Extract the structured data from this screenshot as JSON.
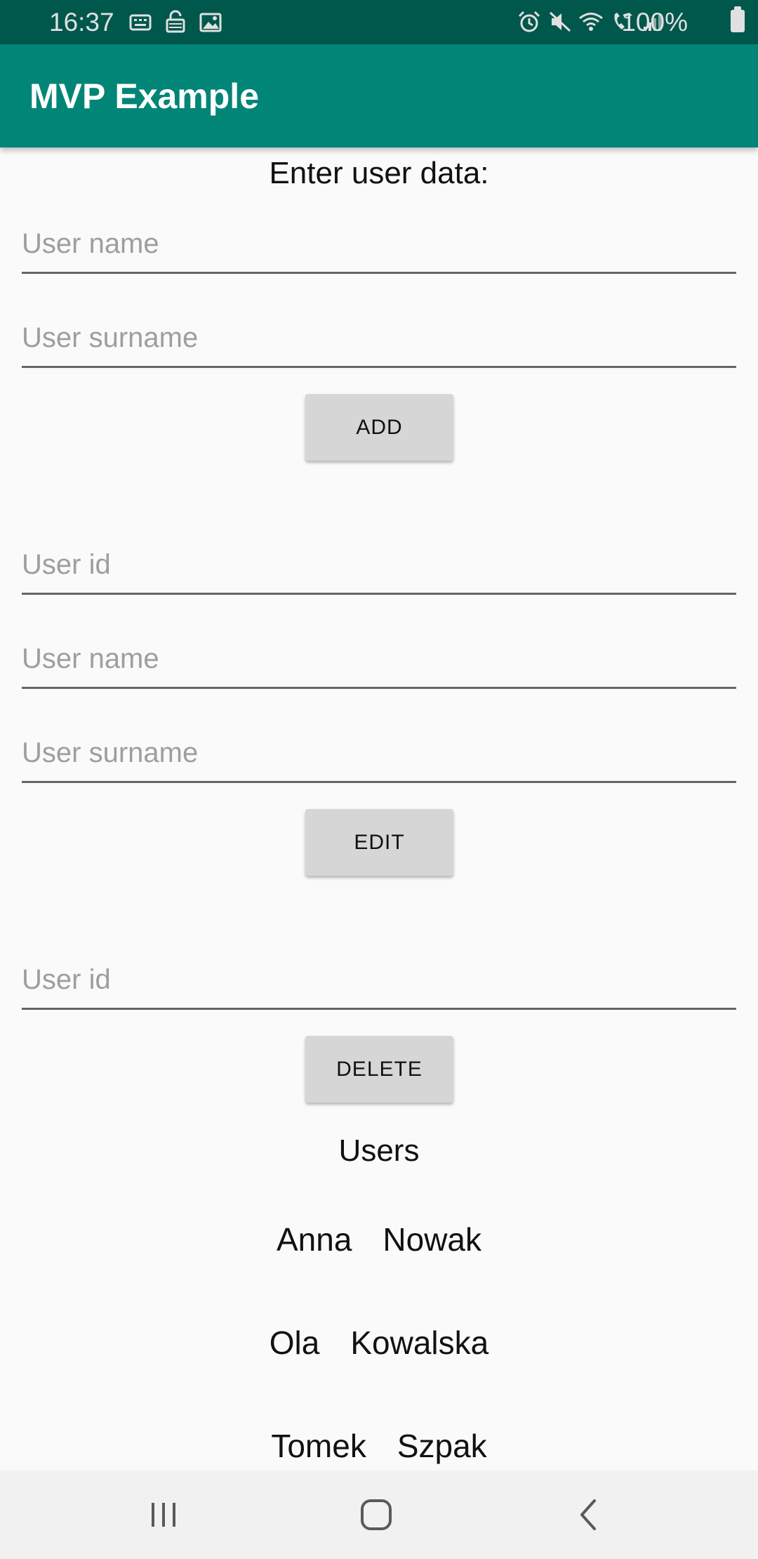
{
  "status_bar": {
    "time": "16:37",
    "battery": "100%",
    "left_icons": [
      "keyboard-icon",
      "lock-icon",
      "image-icon"
    ],
    "right_icons": [
      "alarm-icon",
      "mute-icon",
      "wifi-icon",
      "wifi-calling-icon",
      "signal-icon"
    ],
    "color": "#00574b"
  },
  "app_bar": {
    "title": "MVP Example",
    "color": "#008577"
  },
  "form": {
    "heading": "Enter user data:",
    "add_section": {
      "name_placeholder": "User name",
      "surname_placeholder": "User surname",
      "button_label": "ADD"
    },
    "edit_section": {
      "id_placeholder": "User id",
      "name_placeholder": "User name",
      "surname_placeholder": "User surname",
      "button_label": "EDIT"
    },
    "delete_section": {
      "id_placeholder": "User id",
      "button_label": "DELETE"
    }
  },
  "users": {
    "title": "Users",
    "list": [
      {
        "name": "Anna",
        "surname": "Nowak"
      },
      {
        "name": "Ola",
        "surname": "Kowalska"
      },
      {
        "name": "Tomek",
        "surname": "Szpak"
      }
    ]
  },
  "nav_bar": {
    "buttons": [
      "recent-apps-icon",
      "home-icon",
      "back-icon"
    ]
  }
}
